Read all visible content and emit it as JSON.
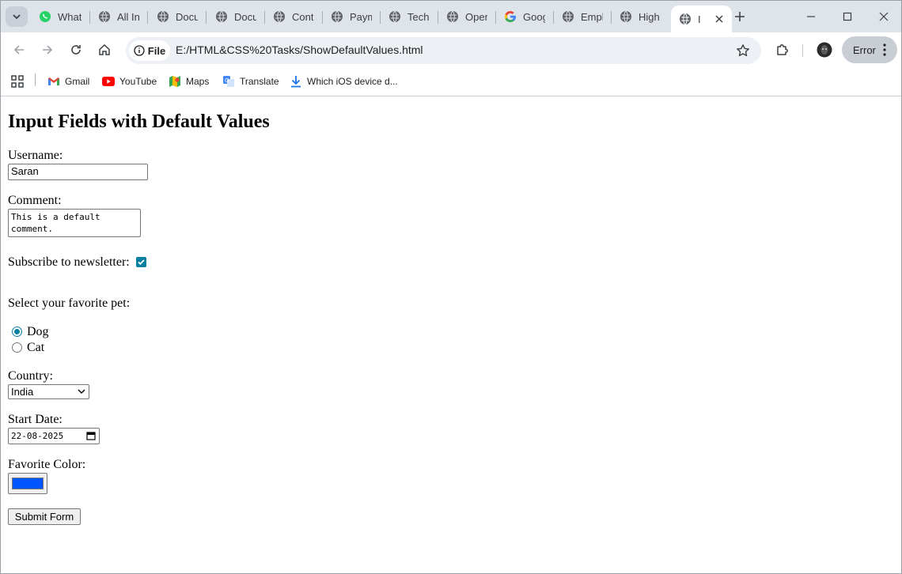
{
  "browser": {
    "tabs": [
      {
        "label": "What",
        "icon": "whatsapp-icon"
      },
      {
        "label": "All In",
        "icon": "globe-icon"
      },
      {
        "label": "Docu",
        "icon": "globe-icon"
      },
      {
        "label": "Docu",
        "icon": "globe-icon"
      },
      {
        "label": "Cont",
        "icon": "globe-icon"
      },
      {
        "label": "Paym",
        "icon": "globe-icon"
      },
      {
        "label": "Tech",
        "icon": "globe-icon"
      },
      {
        "label": "Oper",
        "icon": "globe-icon"
      },
      {
        "label": "Goog",
        "icon": "google-icon"
      },
      {
        "label": "Empl",
        "icon": "globe-icon"
      },
      {
        "label": "High",
        "icon": "globe-icon"
      },
      {
        "label": "I",
        "icon": "globe-icon",
        "active": true
      }
    ],
    "address": {
      "site_chip": "File",
      "url": "E:/HTML&CSS%20Tasks/ShowDefaultValues.html"
    },
    "profile_button": "Error",
    "bookmarks": [
      {
        "label": "Gmail",
        "icon": "gmail-icon"
      },
      {
        "label": "YouTube",
        "icon": "youtube-icon"
      },
      {
        "label": "Maps",
        "icon": "maps-icon"
      },
      {
        "label": "Translate",
        "icon": "translate-icon"
      },
      {
        "label": "Which iOS device d...",
        "icon": "download-icon"
      }
    ]
  },
  "page": {
    "heading": "Input Fields with Default Values",
    "username": {
      "label": "Username:",
      "value": "Saran"
    },
    "comment": {
      "label": "Comment:",
      "value": "This is a default\ncomment."
    },
    "newsletter": {
      "label": "Subscribe to newsletter:",
      "checked": true
    },
    "pet": {
      "label": "Select your favorite pet:",
      "options": [
        {
          "label": "Dog",
          "selected": true
        },
        {
          "label": "Cat",
          "selected": false
        }
      ]
    },
    "country": {
      "label": "Country:",
      "value": "India"
    },
    "start_date": {
      "label": "Start Date:",
      "value": "22-08-2025"
    },
    "favorite_color": {
      "label": "Favorite Color:",
      "value": "#0055ff"
    },
    "submit_label": "Submit Form"
  },
  "colors": {
    "accent": "#0b7fa3",
    "tabstrip": "#dfe3ea",
    "omnibox": "#edf0f4"
  }
}
